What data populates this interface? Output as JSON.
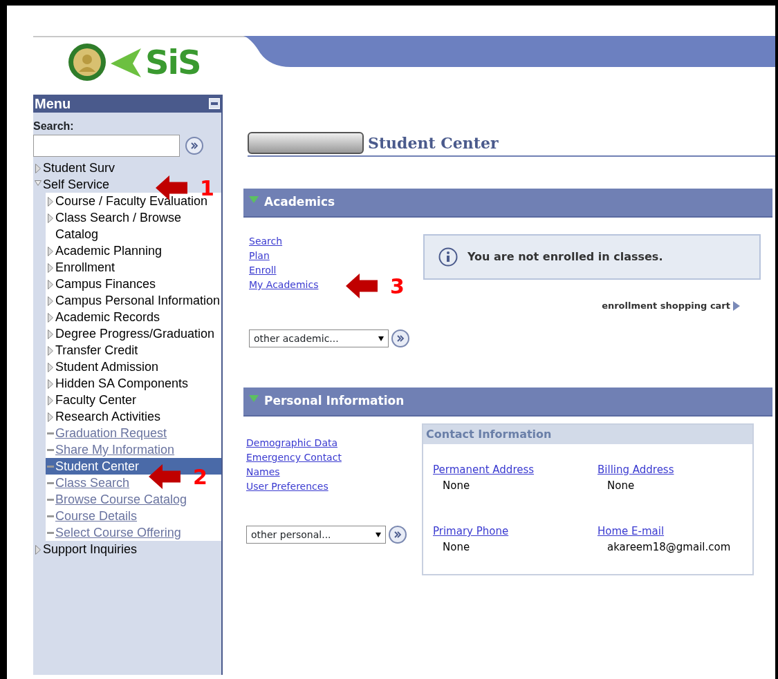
{
  "header": {
    "logo_text": "SiS"
  },
  "menu": {
    "title": "Menu",
    "search_label": "Search:",
    "items": [
      {
        "label": "Student Surv",
        "kind": "folder",
        "expanded": false,
        "selected": false
      },
      {
        "label": "Self Service",
        "kind": "folder",
        "expanded": true,
        "selected": false,
        "children": [
          {
            "label": "Course / Faculty Evaluation",
            "kind": "folder",
            "expanded": false,
            "selected": false
          },
          {
            "label": "Class Search / Browse Catalog",
            "kind": "folder",
            "expanded": false,
            "selected": false
          },
          {
            "label": "Academic Planning",
            "kind": "folder",
            "expanded": false,
            "selected": false
          },
          {
            "label": "Enrollment",
            "kind": "folder",
            "expanded": false,
            "selected": false
          },
          {
            "label": "Campus Finances",
            "kind": "folder",
            "expanded": false,
            "selected": false
          },
          {
            "label": "Campus Personal Information",
            "kind": "folder",
            "expanded": false,
            "selected": false
          },
          {
            "label": "Academic Records",
            "kind": "folder",
            "expanded": false,
            "selected": false
          },
          {
            "label": "Degree Progress/Graduation",
            "kind": "folder",
            "expanded": false,
            "selected": false
          },
          {
            "label": "Transfer Credit",
            "kind": "folder",
            "expanded": false,
            "selected": false
          },
          {
            "label": "Student Admission",
            "kind": "folder",
            "expanded": false,
            "selected": false
          },
          {
            "label": "Hidden SA Components",
            "kind": "folder",
            "expanded": false,
            "selected": false
          },
          {
            "label": "Faculty Center",
            "kind": "folder",
            "expanded": false,
            "selected": false
          },
          {
            "label": "Research Activities",
            "kind": "folder",
            "expanded": false,
            "selected": false
          },
          {
            "label": "Graduation Request",
            "kind": "link",
            "selected": false
          },
          {
            "label": "Share My Information",
            "kind": "link",
            "selected": false
          },
          {
            "label": "Student Center",
            "kind": "link",
            "selected": true
          },
          {
            "label": "Class Search",
            "kind": "link",
            "selected": false
          },
          {
            "label": "Browse Course Catalog",
            "kind": "link",
            "selected": false
          },
          {
            "label": "Course Details",
            "kind": "link",
            "selected": false
          },
          {
            "label": "Select Course Offering",
            "kind": "link",
            "selected": false
          }
        ]
      },
      {
        "label": "Support Inquiries",
        "kind": "folder",
        "expanded": false,
        "selected": false
      }
    ]
  },
  "page_title": "Student Center",
  "academics": {
    "title": "Academics",
    "expanded": true,
    "links": [
      "Search",
      "Plan",
      "Enroll",
      "My Academics"
    ],
    "dropdown": {
      "value": "other academic..."
    },
    "message": "You are not enrolled in classes.",
    "cart_link": "enrollment shopping cart"
  },
  "personal": {
    "title": "Personal Information",
    "expanded": true,
    "links": [
      "Demographic Data",
      "Emergency Contact",
      "Names",
      "User Preferences"
    ],
    "dropdown": {
      "value": "other personal..."
    },
    "contact": {
      "title": "Contact Information",
      "fields": [
        {
          "label": "Permanent Address",
          "value": "None"
        },
        {
          "label": "Billing Address",
          "value": "None"
        },
        {
          "label": "Primary Phone",
          "value": "None"
        },
        {
          "label": "Home E-mail",
          "value": "akareem18@gmail.com"
        }
      ]
    }
  },
  "annotations": [
    {
      "label": "1"
    },
    {
      "label": "2"
    },
    {
      "label": "3"
    }
  ]
}
